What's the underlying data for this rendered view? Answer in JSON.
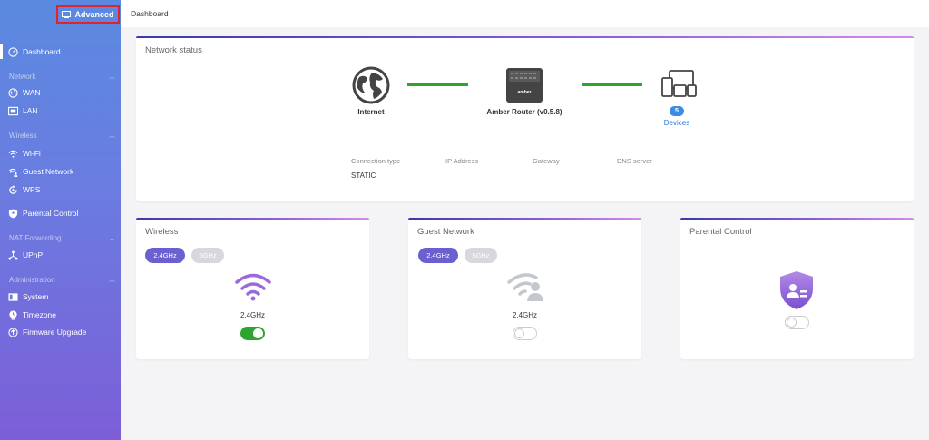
{
  "sidebar": {
    "advanced_label": "Advanced",
    "items": {
      "dashboard": "Dashboard",
      "wan": "WAN",
      "lan": "LAN",
      "wifi": "Wi-Fi",
      "guest_network": "Guest Network",
      "wps": "WPS",
      "parental_control": "Parental Control",
      "upnp": "UPnP",
      "system": "System",
      "timezone": "Timezone",
      "firmware_upgrade": "Firmware Upgrade"
    },
    "groups": {
      "network": "Network",
      "wireless": "Wireless",
      "nat_forwarding": "NAT Forwarding",
      "administration": "Administration"
    }
  },
  "topbar": {
    "breadcrumb": "Dashboard"
  },
  "network_status": {
    "title": "Network status",
    "internet_label": "Internet",
    "router_label": "Amber Router (v0.5.8)",
    "router_brand": "amber",
    "devices_count": "5",
    "devices_label": "Devices",
    "connection_type_label": "Connection type",
    "connection_type_value": "STATIC",
    "ip_address_label": "IP Address",
    "gateway_label": "Gateway",
    "dns_server_label": "DNS server"
  },
  "wireless_card": {
    "title": "Wireless",
    "band_24": "2.4GHz",
    "band_5": "5GHz",
    "selected_band_label": "2.4GHz",
    "enabled": true
  },
  "guest_card": {
    "title": "Guest Network",
    "band_24": "2.4GHz",
    "band_5": "5GHz",
    "selected_band_label": "2.4GHz",
    "enabled": false
  },
  "parental_card": {
    "title": "Parental Control",
    "enabled": false
  },
  "colors": {
    "accent_purple": "#6a60d0",
    "toggle_on": "#2fa52f",
    "link_blue": "#2a7ad9",
    "highlight_red": "#e0232f"
  }
}
